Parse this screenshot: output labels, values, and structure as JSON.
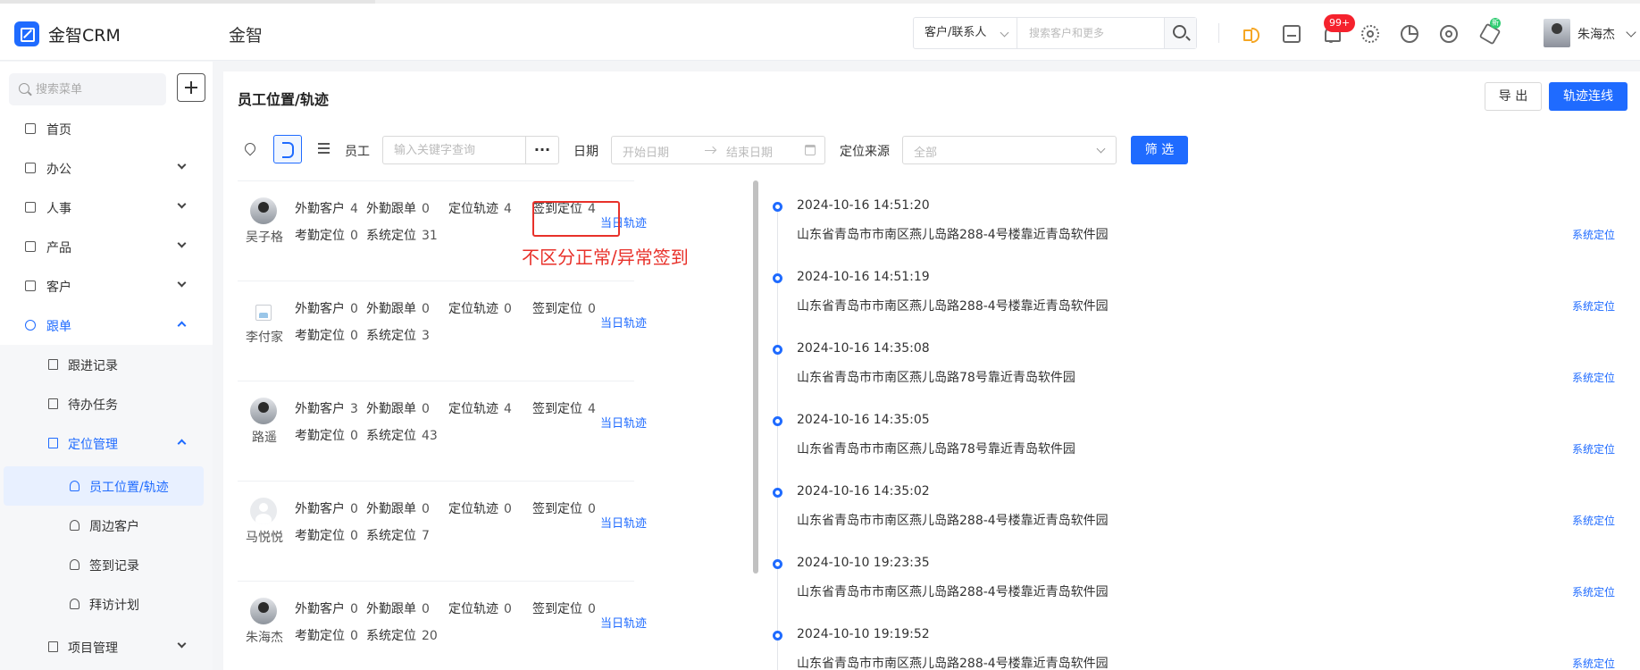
{
  "header": {
    "brand": "金智CRM",
    "company": "金智",
    "search_type": "客户/联系人",
    "search_placeholder": "搜索客户和更多",
    "notification_badge": "99+",
    "new_badge": "新",
    "username": "朱海杰"
  },
  "sidebar": {
    "search_placeholder": "搜索菜单",
    "items": [
      {
        "label": "首页"
      },
      {
        "label": "办公"
      },
      {
        "label": "人事"
      },
      {
        "label": "产品"
      },
      {
        "label": "客户"
      },
      {
        "label": "跟单"
      }
    ],
    "sub": {
      "followup": "跟进记录",
      "todo": "待办任务",
      "location": "定位管理",
      "employee_track": "员工位置/轨迹",
      "nearby": "周边客户",
      "checkin": "签到记录",
      "visit_plan": "拜访计划",
      "project": "项目管理"
    }
  },
  "main": {
    "title": "员工位置/轨迹",
    "export_label": "导 出",
    "track_label": "轨迹连线",
    "filters": {
      "employee_label": "员工",
      "keyword_placeholder": "输入关键字查询",
      "more": "···",
      "date_label": "日期",
      "start_placeholder": "开始日期",
      "end_placeholder": "结束日期",
      "source_label": "定位来源",
      "source_value": "全部",
      "filter_button": "筛 选"
    },
    "stat_labels": {
      "field_customer": "外勤客户",
      "field_order": "外勤跟单",
      "track": "定位轨迹",
      "checkin": "签到定位",
      "attendance": "考勤定位",
      "system": "系统定位"
    },
    "today_track": "当日轨迹",
    "employees": [
      {
        "name": "吴子格",
        "field_customer": "4",
        "field_order": "0",
        "track": "4",
        "checkin": "4",
        "attendance": "0",
        "system": "31"
      },
      {
        "name": "李付家",
        "field_customer": "0",
        "field_order": "0",
        "track": "0",
        "checkin": "0",
        "attendance": "0",
        "system": "3"
      },
      {
        "name": "路遥",
        "field_customer": "3",
        "field_order": "0",
        "track": "4",
        "checkin": "4",
        "attendance": "0",
        "system": "43"
      },
      {
        "name": "马悦悦",
        "field_customer": "0",
        "field_order": "0",
        "track": "0",
        "checkin": "0",
        "attendance": "0",
        "system": "7"
      },
      {
        "name": "朱海杰",
        "field_customer": "0",
        "field_order": "0",
        "track": "0",
        "checkin": "0",
        "attendance": "0",
        "system": "20"
      }
    ],
    "annotation": "不区分正常/异常签到",
    "timeline": [
      {
        "time": "2024-10-16 14:51:20",
        "address": "山东省青岛市市南区燕儿岛路288-4号楼靠近青岛软件园",
        "source": "系统定位"
      },
      {
        "time": "2024-10-16 14:51:19",
        "address": "山东省青岛市市南区燕儿岛路288-4号楼靠近青岛软件园",
        "source": "系统定位"
      },
      {
        "time": "2024-10-16 14:35:08",
        "address": "山东省青岛市市南区燕儿岛路78号靠近青岛软件园",
        "source": "系统定位"
      },
      {
        "time": "2024-10-16 14:35:05",
        "address": "山东省青岛市市南区燕儿岛路78号靠近青岛软件园",
        "source": "系统定位"
      },
      {
        "time": "2024-10-16 14:35:02",
        "address": "山东省青岛市市南区燕儿岛路288-4号楼靠近青岛软件园",
        "source": "系统定位"
      },
      {
        "time": "2024-10-10 19:23:35",
        "address": "山东省青岛市市南区燕儿岛路288-4号楼靠近青岛软件园",
        "source": "系统定位"
      },
      {
        "time": "2024-10-10 19:19:52",
        "address": "山东省青岛市市南区燕儿岛路288-4号楼靠近青岛软件园",
        "source": "系统定位"
      }
    ]
  }
}
